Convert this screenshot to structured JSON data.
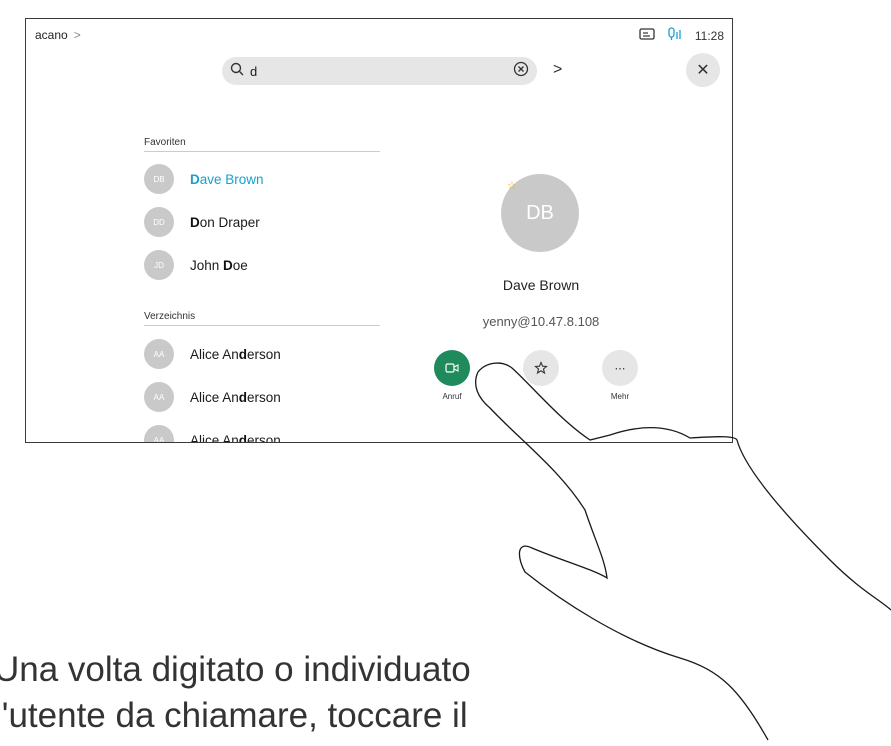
{
  "topbar": {
    "breadcrumb": "acano",
    "time": "11:28"
  },
  "search": {
    "query": "d"
  },
  "favorites": {
    "heading": "Favoriten",
    "items": [
      {
        "initials": "DB",
        "prefix": "",
        "highlight": "D",
        "suffix": "ave Brown",
        "active": true
      },
      {
        "initials": "DD",
        "prefix": "",
        "highlight": "D",
        "suffix": "on Draper",
        "active": false
      },
      {
        "initials": "JD",
        "prefix": "John ",
        "highlight": "D",
        "suffix": "oe",
        "active": false
      }
    ]
  },
  "directory": {
    "heading": "Verzeichnis",
    "items": [
      {
        "initials": "AA",
        "prefix": "Alice An",
        "highlight": "d",
        "suffix": "erson"
      },
      {
        "initials": "AA",
        "prefix": "Alice An",
        "highlight": "d",
        "suffix": "erson"
      },
      {
        "initials": "AA",
        "prefix": "Alice An",
        "highlight": "d",
        "suffix": "erson"
      }
    ]
  },
  "detail": {
    "initials": "DB",
    "name": "Dave Brown",
    "address": "yenny@10.47.8.108",
    "actions": {
      "call_label": "Anruf",
      "more_label": "Mehr"
    }
  },
  "caption": {
    "line1": "Una volta digitato o individuato",
    "line2": "l'utente da chiamare, toccare il"
  },
  "colors": {
    "call_green": "#1f8a5c",
    "highlight_blue": "#1ba0cc",
    "favorite_star": "#f0b400"
  },
  "icons": [
    "search-icon",
    "clear-icon",
    "chevron-right-icon",
    "close-icon",
    "camera-call-icon",
    "star-icon",
    "more-icon",
    "self-view-icon",
    "microphone-icon"
  ]
}
